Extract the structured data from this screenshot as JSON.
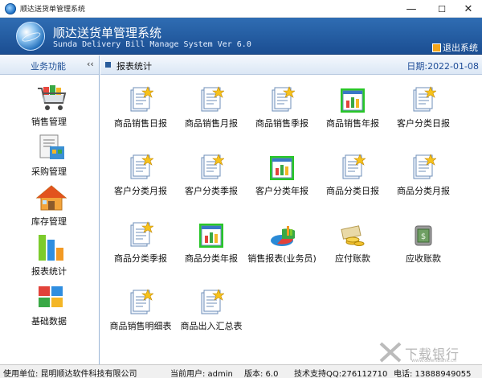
{
  "window": {
    "title": "顺达送货单管理系统",
    "minimize_glyph": "—",
    "maximize_glyph": "☐",
    "close_glyph": "✕"
  },
  "banner": {
    "title_cn": "顺达送货单管理系统",
    "title_en": "Sunda Delivery Bill Manage System Ver 6.0",
    "exit_label": "退出系统"
  },
  "sidebar": {
    "header": "业务功能",
    "collapse_glyph": "‹‹",
    "items": [
      {
        "label": "销售管理",
        "icon": "shopping-cart-icon"
      },
      {
        "label": "采购管理",
        "icon": "purchase-document-icon"
      },
      {
        "label": "库存管理",
        "icon": "house-icon"
      },
      {
        "label": "报表统计",
        "icon": "bar-chart-icon"
      },
      {
        "label": "基础数据",
        "icon": "cubes-icon"
      }
    ]
  },
  "main": {
    "title": "报表统计",
    "date": "日期:2022-01-08",
    "reports": [
      {
        "label": "商品销售日报",
        "icon": "report-star-icon"
      },
      {
        "label": "商品销售月报",
        "icon": "report-star-icon"
      },
      {
        "label": "商品销售季报",
        "icon": "report-star-icon"
      },
      {
        "label": "商品销售年报",
        "icon": "report-chart-icon"
      },
      {
        "label": "客户分类日报",
        "icon": "report-star-icon"
      },
      {
        "label": "客户分类月报",
        "icon": "report-star-icon"
      },
      {
        "label": "客户分类季报",
        "icon": "report-star-icon"
      },
      {
        "label": "客户分类年报",
        "icon": "report-chart-icon"
      },
      {
        "label": "商品分类日报",
        "icon": "report-star-icon"
      },
      {
        "label": "商品分类月报",
        "icon": "report-star-icon"
      },
      {
        "label": "商品分类季报",
        "icon": "report-star-icon"
      },
      {
        "label": "商品分类年报",
        "icon": "report-chart-icon"
      },
      {
        "label": "销售报表(业务员)",
        "icon": "pie-chart-icon"
      },
      {
        "label": "应付账款",
        "icon": "coins-icon"
      },
      {
        "label": "应收账款",
        "icon": "money-icon"
      },
      {
        "label": "商品销售明细表",
        "icon": "report-star-icon"
      },
      {
        "label": "商品出入汇总表",
        "icon": "report-star-icon"
      }
    ]
  },
  "status": {
    "unit": "使用单位: 昆明顺达软件科技有限公司",
    "user": "当前用户: admin",
    "version": "版本: 6.0",
    "support": "技术支持QQ:276112710",
    "phone": "电话: 13888949055"
  },
  "watermark": {
    "text": "下载银行",
    "url": "www.downbank.cn"
  },
  "colors": {
    "banner": "#2f6db3",
    "accent": "#1f4d98",
    "highlight": "#28c628"
  }
}
